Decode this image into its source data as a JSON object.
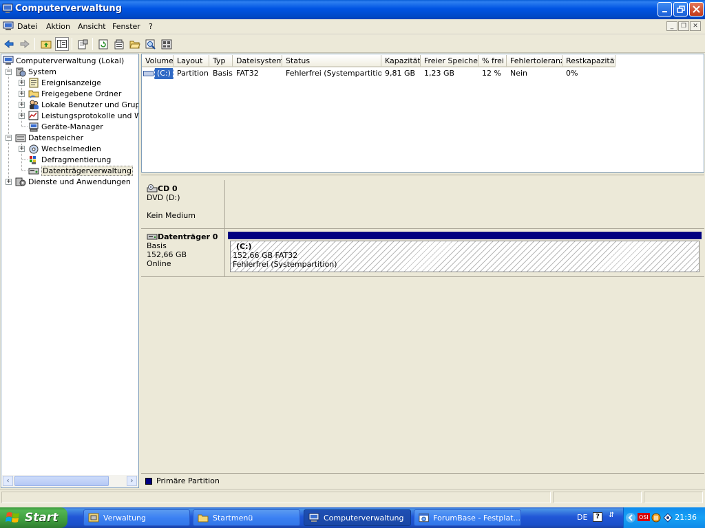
{
  "window": {
    "title": "Computerverwaltung"
  },
  "menu": {
    "items": [
      "Datei",
      "Aktion",
      "Ansicht",
      "Fenster",
      "?"
    ]
  },
  "tree": {
    "root": "Computerverwaltung (Lokal)",
    "system": "System",
    "system_children": [
      "Ereignisanzeige",
      "Freigegebene Ordner",
      "Lokale Benutzer und Gruppen",
      "Leistungsprotokolle und Warnungen",
      "Geräte-Manager"
    ],
    "storage": "Datenspeicher",
    "storage_children": [
      "Wechselmedien",
      "Defragmentierung",
      "Datenträgerverwaltung"
    ],
    "services": "Dienste und Anwendungen"
  },
  "volume_list": {
    "columns": [
      "Volume",
      "Layout",
      "Typ",
      "Dateisystem",
      "Status",
      "Kapazität",
      "Freier Speicher",
      "% frei",
      "Fehlertoleranz",
      "Restkapazität"
    ],
    "rows": [
      [
        "(C:)",
        "Partition",
        "Basis",
        "FAT32",
        "Fehlerfrei (Systempartition)",
        "9,81 GB",
        "1,23 GB",
        "12 %",
        "Nein",
        "0%"
      ]
    ]
  },
  "disks": {
    "cd": {
      "name": "CD 0",
      "type": "DVD (D:)",
      "media": "Kein Medium"
    },
    "disk0": {
      "name": "Datenträger 0",
      "kind": "Basis",
      "size": "152,66 GB",
      "state": "Online",
      "partition": {
        "label": "(C:)",
        "size_fs": "152,66 GB FAT32",
        "status": "Fehlerfrei (Systempartition)"
      }
    }
  },
  "legend": {
    "primary": "Primäre Partition"
  },
  "taskbar": {
    "start": "Start",
    "tasks": [
      "Verwaltung",
      "Startmenü",
      "Computerverwaltung",
      "ForumBase - Festplat..."
    ],
    "language": "DE",
    "clock": "21:36"
  },
  "colors": {
    "primary_partition": "#000080",
    "titlebar": "#0054e3",
    "selection": "#316ac5"
  }
}
